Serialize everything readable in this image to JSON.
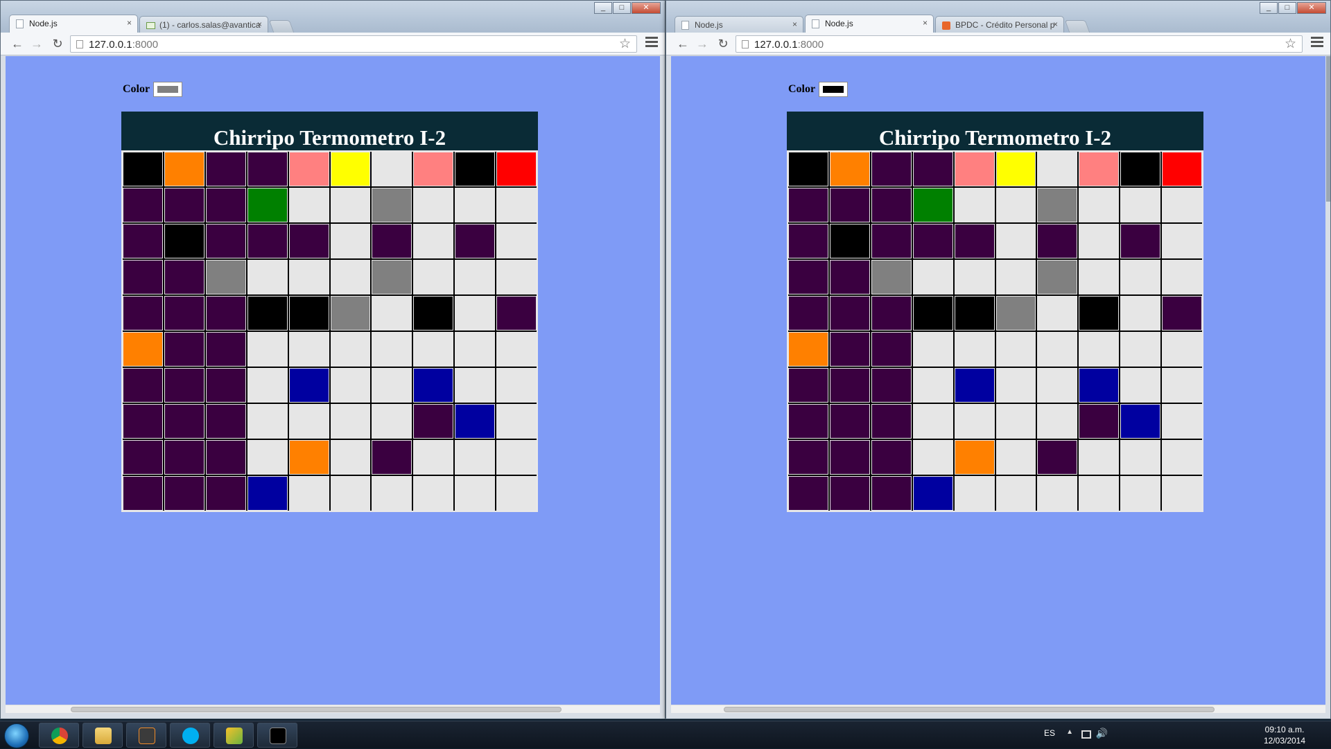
{
  "left_window": {
    "tabs": [
      {
        "label": "Node.js",
        "active": true,
        "icon": "page-icon"
      },
      {
        "label": "(1) - carlos.salas@avantica",
        "active": false,
        "icon": "mail-icon"
      }
    ],
    "address": {
      "host": "127.0.0.1",
      "port": ":8000"
    },
    "page": {
      "color_label": "Color",
      "selected_color": "#808080",
      "board_title": "Chirripo Termometro I-2"
    },
    "hscroll_thumb": {
      "offset": 0.1,
      "size": 0.75
    }
  },
  "right_window": {
    "tabs": [
      {
        "label": "Node.js",
        "active": false,
        "icon": "page-icon"
      },
      {
        "label": "Node.js",
        "active": true,
        "icon": "page-icon"
      },
      {
        "label": "BPDC - Crédito Personal p",
        "active": false,
        "icon": "bank-icon"
      }
    ],
    "address": {
      "host": "127.0.0.1",
      "port": ":8000"
    },
    "page": {
      "color_label": "Color",
      "selected_color": "#000000",
      "board_title": "Chirripo Termometro I-2"
    },
    "hscroll_thumb": {
      "offset": 0.08,
      "size": 0.75
    }
  },
  "palette": {
    "K": "#000000",
    "O": "#ff8000",
    "P": "#3a0040",
    "R": "#ff8080",
    "Y": "#ffff00",
    "W": "#e6e6e6",
    "D": "#ff0000",
    "G": "#008000",
    "A": "#808080",
    "B": "#0000a0"
  },
  "grid_rows": [
    "KOPPRYWRKD",
    "PPPGWWAWWW",
    "PKPPPWPWPW",
    "PPAWWWAWWW",
    "PPPKKAWKWP",
    "OPPWWWWWWW",
    "PPPWBWWBWW",
    "PPPWWWWPBW",
    "PPPWOWPWWW",
    "PPPBWWWWWW"
  ],
  "taskbar": {
    "language": "ES",
    "time": "09:10 a.m.",
    "date": "12/03/2014"
  }
}
